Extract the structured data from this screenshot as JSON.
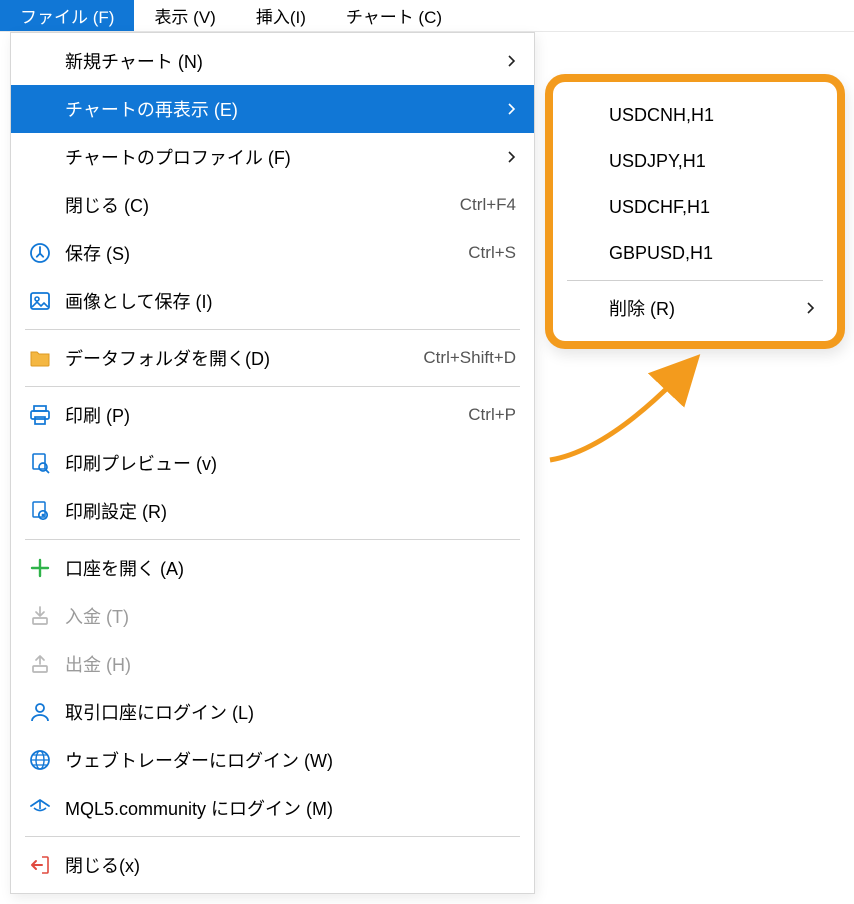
{
  "menubar": {
    "items": [
      {
        "label": "ファイル (F)",
        "active": true
      },
      {
        "label": "表示 (V)",
        "active": false
      },
      {
        "label": "挿入(I)",
        "active": false
      },
      {
        "label": "チャート (C)",
        "active": false
      }
    ]
  },
  "menu": {
    "items": [
      {
        "type": "item",
        "icon": "",
        "label": "新規チャート (N)",
        "shortcut": "",
        "arrow": true,
        "disabled": false,
        "highlighted": false
      },
      {
        "type": "item",
        "icon": "",
        "label": "チャートの再表示 (E)",
        "shortcut": "",
        "arrow": true,
        "disabled": false,
        "highlighted": true
      },
      {
        "type": "item",
        "icon": "",
        "label": "チャートのプロファイル (F)",
        "shortcut": "",
        "arrow": true,
        "disabled": false,
        "highlighted": false
      },
      {
        "type": "item",
        "icon": "",
        "label": "閉じる (C)",
        "shortcut": "Ctrl+F4",
        "arrow": false,
        "disabled": false,
        "highlighted": false
      },
      {
        "type": "item",
        "icon": "save-icon",
        "label": "保存 (S)",
        "shortcut": "Ctrl+S",
        "arrow": false,
        "disabled": false,
        "highlighted": false
      },
      {
        "type": "item",
        "icon": "image-icon",
        "label": "画像として保存 (I)",
        "shortcut": "",
        "arrow": false,
        "disabled": false,
        "highlighted": false
      },
      {
        "type": "sep"
      },
      {
        "type": "item",
        "icon": "folder-icon",
        "label": "データフォルダを開く(D)",
        "shortcut": "Ctrl+Shift+D",
        "arrow": false,
        "disabled": false,
        "highlighted": false
      },
      {
        "type": "sep"
      },
      {
        "type": "item",
        "icon": "print-icon",
        "label": "印刷 (P)",
        "shortcut": "Ctrl+P",
        "arrow": false,
        "disabled": false,
        "highlighted": false
      },
      {
        "type": "item",
        "icon": "preview-icon",
        "label": "印刷プレビュー (v)",
        "shortcut": "",
        "arrow": false,
        "disabled": false,
        "highlighted": false
      },
      {
        "type": "item",
        "icon": "settings-icon",
        "label": "印刷設定 (R)",
        "shortcut": "",
        "arrow": false,
        "disabled": false,
        "highlighted": false
      },
      {
        "type": "sep"
      },
      {
        "type": "item",
        "icon": "plus-icon",
        "label": "口座を開く (A)",
        "shortcut": "",
        "arrow": false,
        "disabled": false,
        "highlighted": false
      },
      {
        "type": "item",
        "icon": "deposit-icon",
        "label": "入金 (T)",
        "shortcut": "",
        "arrow": false,
        "disabled": true,
        "highlighted": false
      },
      {
        "type": "item",
        "icon": "withdraw-icon",
        "label": "出金 (H)",
        "shortcut": "",
        "arrow": false,
        "disabled": true,
        "highlighted": false
      },
      {
        "type": "item",
        "icon": "user-icon",
        "label": "取引口座にログイン (L)",
        "shortcut": "",
        "arrow": false,
        "disabled": false,
        "highlighted": false
      },
      {
        "type": "item",
        "icon": "globe-icon",
        "label": "ウェブトレーダーにログイン (W)",
        "shortcut": "",
        "arrow": false,
        "disabled": false,
        "highlighted": false
      },
      {
        "type": "item",
        "icon": "mql-icon",
        "label": "MQL5.community にログイン (M)",
        "shortcut": "",
        "arrow": false,
        "disabled": false,
        "highlighted": false
      },
      {
        "type": "sep"
      },
      {
        "type": "item",
        "icon": "exit-icon",
        "label": "閉じる(x)",
        "shortcut": "",
        "arrow": false,
        "disabled": false,
        "highlighted": false
      }
    ]
  },
  "submenu": {
    "items": [
      {
        "label": "USDCNH,H1"
      },
      {
        "label": "USDJPY,H1"
      },
      {
        "label": "USDCHF,H1"
      },
      {
        "label": "GBPUSD,H1"
      }
    ],
    "delete_label": "削除 (R)"
  },
  "colors": {
    "highlight": "#1177d6",
    "accent_border": "#f39b1d",
    "icon_blue": "#1177d6",
    "icon_orange": "#f39b1d",
    "disabled": "#9b9b9b",
    "plus_green": "#2fb34a",
    "exit_red": "#e04a3f"
  }
}
